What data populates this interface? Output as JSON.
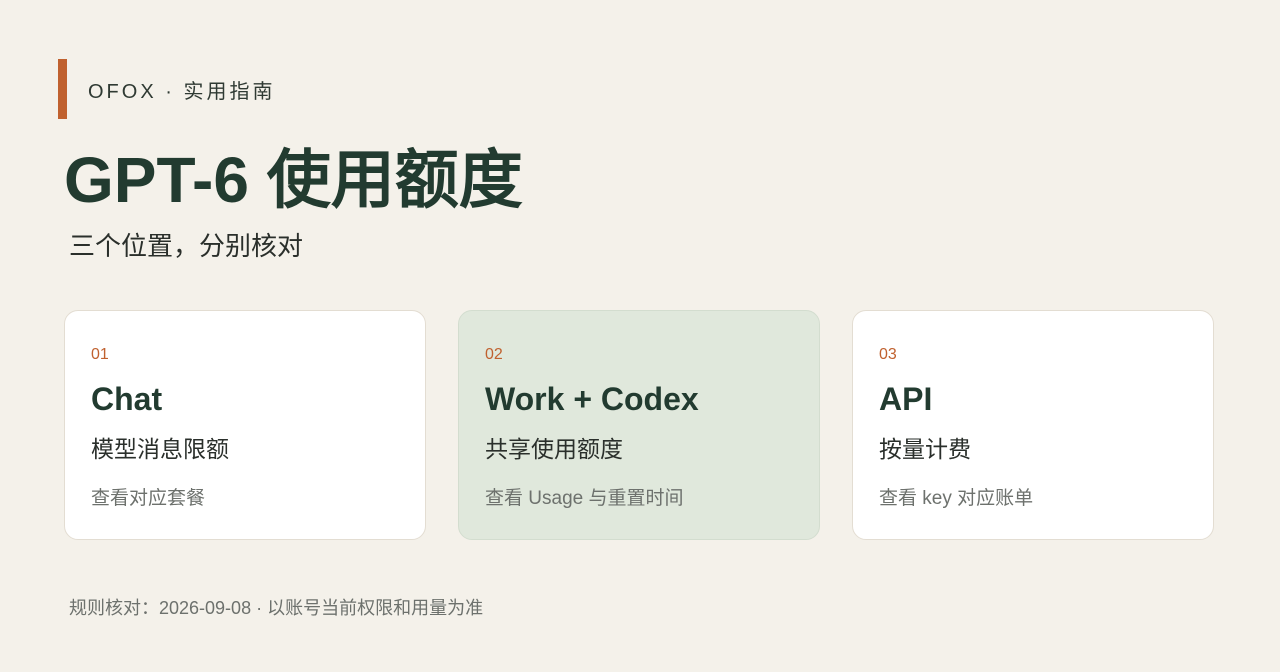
{
  "header": {
    "brand": "OFOX · 实用指南",
    "title": "GPT-6 使用额度",
    "subtitle": "三个位置，分别核对"
  },
  "cards": [
    {
      "number": "01",
      "title": "Chat",
      "subtitle": "模型消息限额",
      "hint": "查看对应套餐"
    },
    {
      "number": "02",
      "title": "Work + Codex",
      "subtitle": "共享使用额度",
      "hint": "查看 Usage 与重置时间"
    },
    {
      "number": "03",
      "title": "API",
      "subtitle": "按量计费",
      "hint": "查看 key 对应账单"
    }
  ],
  "footer": {
    "note": "规则核对：2026-09-08 · 以账号当前权限和用量为准"
  },
  "colors": {
    "background": "#f4f1ea",
    "accent": "#c0612f",
    "title": "#223b30",
    "highlight_card": "#e0e8dc"
  }
}
